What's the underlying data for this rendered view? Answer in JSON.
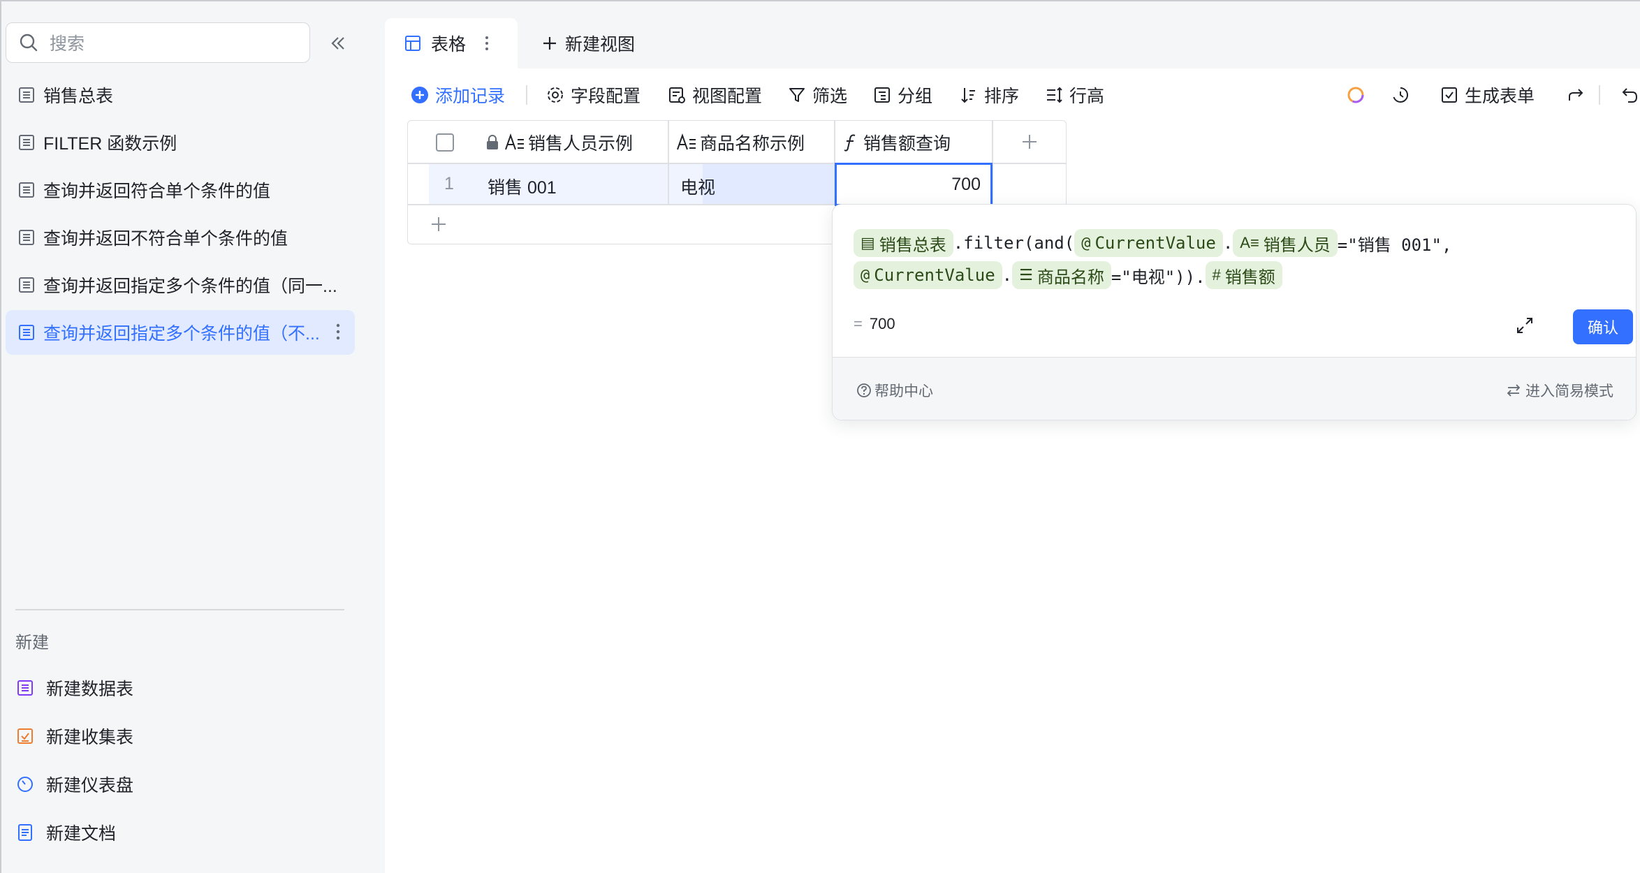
{
  "sidebar": {
    "search_placeholder": "搜索",
    "tables": [
      {
        "label": "销售总表"
      },
      {
        "label": "FILTER 函数示例"
      },
      {
        "label": "查询并返回符合单个条件的值"
      },
      {
        "label": "查询并返回不符合单个条件的值"
      },
      {
        "label": "查询并返回指定多个条件的值（同一..."
      },
      {
        "label": "查询并返回指定多个条件的值（不..."
      }
    ],
    "new_section_label": "新建",
    "new_items": [
      {
        "label": "新建数据表"
      },
      {
        "label": "新建收集表"
      },
      {
        "label": "新建仪表盘"
      },
      {
        "label": "新建文档"
      }
    ]
  },
  "views": {
    "active_tab": "表格",
    "new_view": "新建视图"
  },
  "toolbar": {
    "add_record": "添加记录",
    "field_config": "字段配置",
    "view_config": "视图配置",
    "filter": "筛选",
    "group": "分组",
    "sort": "排序",
    "row_height": "行高",
    "generate_form": "生成表单"
  },
  "grid": {
    "columns": [
      "销售人员示例",
      "商品名称示例",
      "销售额查询"
    ],
    "rows": [
      {
        "index": "1",
        "salesperson": "销售 001",
        "product": "电视",
        "amount": "700"
      }
    ]
  },
  "formula": {
    "chip_table": "销售总表",
    "text_filter": ".filter(and(",
    "chip_current1": "CurrentValue",
    "dot1": ".",
    "chip_salesperson": "销售人员",
    "text_eq1": "=\"销售 001\",",
    "chip_current2": "CurrentValue",
    "dot2": ".",
    "chip_product": "商品名称",
    "text_eq2": "=\"电视\")).",
    "chip_amount": "销售额",
    "result_eq": "=",
    "result_value": "700",
    "confirm": "确认",
    "help_center": "帮助中心",
    "simple_mode": "进入简易模式"
  },
  "colors": {
    "accent": "#3370ff",
    "chip_bg": "#e4f1dc",
    "active_bg": "#e1eaff"
  }
}
